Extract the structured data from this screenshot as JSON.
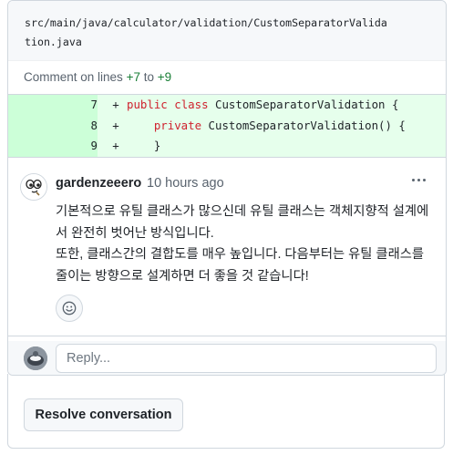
{
  "file": {
    "path_line1": "src/main/java/calculator/validation/CustomSeparatorValida",
    "path_line2": "tion.java"
  },
  "comment_on": {
    "prefix": "Comment on lines ",
    "start": "+7",
    "to": " to ",
    "end": "+9"
  },
  "diff": {
    "lines": [
      {
        "num": "7",
        "sign": "+",
        "indent": "",
        "kw1": "public",
        "kw2": "class",
        "rest": "CustomSeparatorValidation {"
      },
      {
        "num": "8",
        "sign": "+",
        "indent": "    ",
        "kw1": "private",
        "kw2": "",
        "rest": "CustomSeparatorValidation() {"
      },
      {
        "num": "9",
        "sign": "+",
        "indent": "    ",
        "kw1": "",
        "kw2": "",
        "rest": "}"
      }
    ]
  },
  "comment": {
    "author": "gardenzeeero",
    "time": "10 hours ago",
    "paragraph1": "기본적으로 유틸 클래스가 많으신데 유틸 클래스는 객체지향적 설계에서 완전히 벗어난 방식입니다.",
    "paragraph2": "또한, 클래스간의 결합도를 매우 높입니다. 다음부터는 유틸 클래스를 줄이는 방향으로 설계하면 더 좋을 것 같습니다!"
  },
  "reply": {
    "placeholder": "Reply..."
  },
  "actions": {
    "resolve_label": "Resolve conversation"
  },
  "icons": {
    "more": "kebab-horizontal-icon",
    "emoji": "smiley-icon"
  }
}
